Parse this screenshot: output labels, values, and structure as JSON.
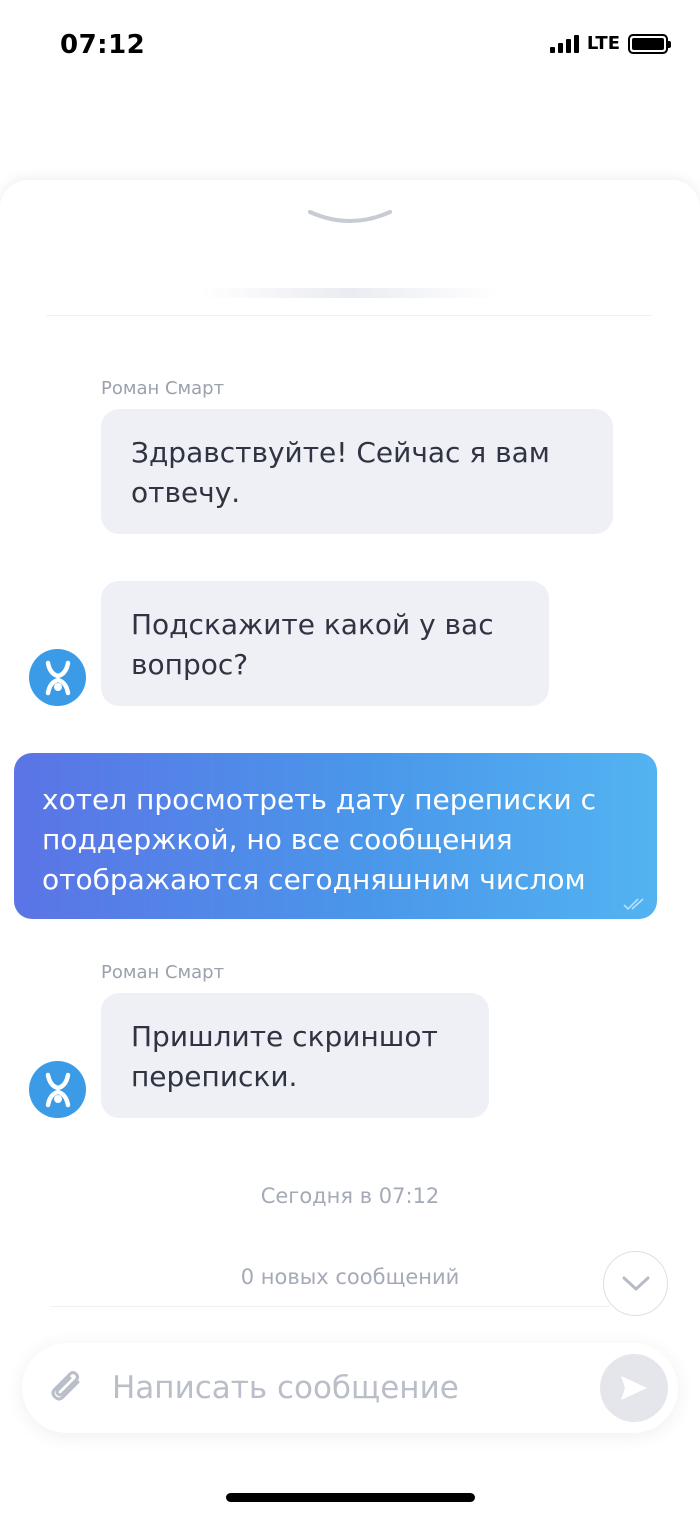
{
  "status_bar": {
    "time": "07:12",
    "network": "LTE"
  },
  "chat": {
    "messages": [
      {
        "sender": "Роман Смарт",
        "text": "Здравствуйте! Сейчас я вам отвечу."
      },
      {
        "text": "Подскажите какой у вас вопрос?"
      },
      {
        "outgoing": true,
        "text": "хотел просмотреть дату переписки с поддержкой, но все сообщения отображаются сегодняшним числом"
      },
      {
        "sender": "Роман Смарт",
        "text": "Пришлите скриншот переписки."
      }
    ],
    "date_label": "Сегодня в 07:12",
    "new_messages": "0 новых сообщений"
  },
  "composer": {
    "placeholder": "Написать сообщение"
  },
  "colors": {
    "avatar": "#3b9be6",
    "bubble_incoming": "#eef0f5",
    "bubble_outgoing_start": "#5b74e6",
    "bubble_outgoing_end": "#53b3f1"
  },
  "icons": {
    "avatar": "yota-logo-icon",
    "attach": "paperclip-icon",
    "send": "send-arrow-icon",
    "scroll": "chevron-down-icon",
    "handle": "chevron-down-icon"
  }
}
